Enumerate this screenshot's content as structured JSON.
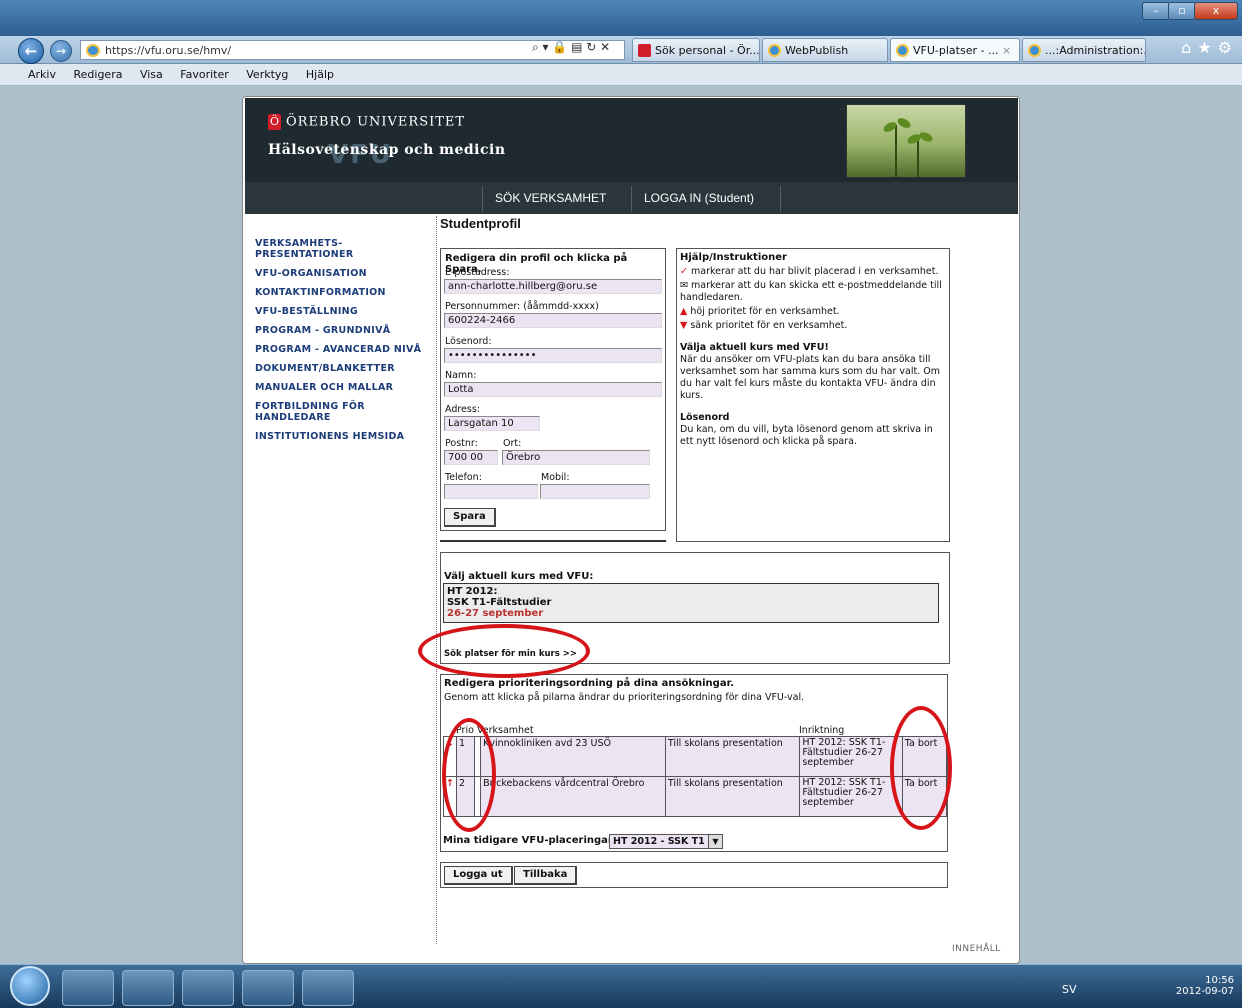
{
  "browser": {
    "url": "https://vfu.oru.se/hmv/",
    "tabs": [
      "Sök personal - Ör...",
      "WebPublish",
      "VFU-platser - ...",
      "...:Administration:..."
    ],
    "menu": [
      "Arkiv",
      "Redigera",
      "Visa",
      "Favoriter",
      "Verktyg",
      "Hjälp"
    ],
    "tab_close": "×"
  },
  "site": {
    "org_name": "ÖREBRO UNIVERSITET",
    "logo_letter": "Ö",
    "dept_name": "Hälsovetenskap och medicin",
    "watermark": "VFU",
    "topnav": [
      "SÖK VERKSAMHET",
      "LOGGA IN (Student)"
    ]
  },
  "leftnav": [
    "VERKSAMHETS-\nPRESENTATIONER",
    "VFU-ORGANISATION",
    "KONTAKTINFORMATION",
    "VFU-BESTÄLLNING",
    "PROGRAM - GRUNDNIVÅ",
    "PROGRAM - AVANCERAD NIVÅ",
    "DOKUMENT/BLANKETTER",
    "MANUALER OCH MALLAR",
    "FORTBILDNING FÖR\nHANDLEDARE",
    "INSTITUTIONENS HEMSIDA"
  ],
  "page_title": "Studentprofil",
  "profile": {
    "heading": "Redigera din profil och klicka på Spara.",
    "email_label": "E-postadress:",
    "email": "ann-charlotte.hillberg@oru.se",
    "pnr_label": "Personnummer: (ååmmdd-xxxx)",
    "pnr": "600224-2466",
    "password_label": "Lösenord:",
    "password": "•••••••••••••••",
    "name_label": "Namn:",
    "name": "Lotta",
    "address_label": "Adress:",
    "address": "Larsgatan 10",
    "zip_label": "Postnr:",
    "zip": "700 00",
    "city_label": "Ort:",
    "city": "Örebro",
    "phone_label": "Telefon:",
    "phone": "",
    "mobile_label": "Mobil:",
    "mobile": "",
    "save_label": "Spara"
  },
  "help": {
    "heading": "Hjälp/Instruktioner",
    "line1_icon": "✓",
    "line1": "markerar att du har blivit placerad i en verksamhet.",
    "line2_icon": "✉",
    "line2": "markerar att du kan skicka ett e-postmeddelande till handledaren.",
    "line3_icon": "▲",
    "line3": "höj prioritet för en verksamhet.",
    "line4_icon": "▼",
    "line4": "sänk prioritet för en verksamhet.",
    "course_heading": "Välja aktuell kurs med VFU!",
    "course_text": "När du ansöker om VFU-plats kan du bara ansöka till verksamhet som har samma kurs som du har valt. Om du har valt fel kurs måste du kontakta VFU- ändra din kurs.",
    "pw_heading": "Lösenord",
    "pw_text": "Du kan, om du vill, byta lösenord genom att skriva in ett nytt lösenord och klicka på spara."
  },
  "course": {
    "heading": "Välj aktuell kurs med VFU:",
    "line1": "HT 2012:",
    "line2": "SSK T1-Fältstudier",
    "line3": "26-27 september",
    "search_link": "Sök platser för min kurs >>"
  },
  "priority": {
    "heading": "Redigera prioriteringsordning på dina ansökningar.",
    "subtext": "Genom att klicka på pilarna ändrar du prioriteringsordning för dina VFU-val.",
    "col_prio": "Prio",
    "col_org": "Verksamhet",
    "col_dir": "Inriktning",
    "rows": [
      {
        "arrow": "↓",
        "prio": "1",
        "org": "Kvinnokliniken avd 23 USÖ",
        "link": "Till skolans presentation",
        "dir": "HT 2012: SSK T1-Fältstudier 26-27 september",
        "remove": "Ta bort"
      },
      {
        "arrow": "↑",
        "prio": "2",
        "org": "Brickebackens vårdcentral Örebro",
        "link": "Till skolans presentation",
        "dir": "HT 2012: SSK T1-Fältstudier 26-27 september",
        "remove": "Ta bort"
      }
    ],
    "prev_label": "Mina tidigare VFU-placeringar",
    "prev_value": "HT 2012 - SSK T1"
  },
  "actions": {
    "logout": "Logga ut",
    "back": "Tillbaka"
  },
  "footer_link": "INNEHÅLL",
  "taskbar": {
    "lang": "SV",
    "time": "10:56",
    "date": "2012-09-07"
  },
  "colors": {
    "nav_link": "#1d3d7a",
    "header_bg": "#1f2a30",
    "annotation_red": "#d6151b",
    "field_bg": "#ece4f3"
  }
}
